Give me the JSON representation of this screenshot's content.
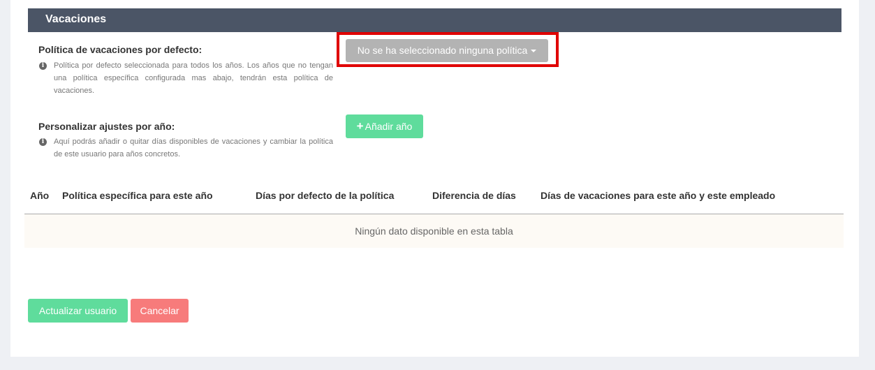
{
  "section": {
    "title": "Vacaciones"
  },
  "default_policy": {
    "label": "Política de vacaciones por defecto:",
    "help": "Política por defecto seleccionada para todos los años. Los años que no tengan una política específica configurada mas abajo, tendrán esta política de vacaciones.",
    "dropdown_value": "No se ha seleccionado ninguna política"
  },
  "custom_year": {
    "label": "Personalizar ajustes por año:",
    "help": "Aquí podrás añadir o quitar días disponibles de vacaciones y cambiar la política de este usuario para años concretos.",
    "add_button": "Añadir año"
  },
  "table": {
    "columns": [
      "Año",
      "Política específica para este año",
      "Días por defecto de la política",
      "Diferencia de días",
      "Días de vacaciones para este año y este empleado"
    ],
    "empty_message": "Ningún dato disponible en esta tabla"
  },
  "actions": {
    "update": "Actualizar usuario",
    "cancel": "Cancelar"
  },
  "colors": {
    "header_bg": "#4b5566",
    "accent_green": "#5fdc9c",
    "cancel_red": "#f77b7b",
    "highlight_red": "#e00000",
    "dropdown_gray": "#b3b3b3"
  },
  "icons": {
    "info": "info-circle-icon",
    "plus": "plus-icon",
    "caret": "caret-down-icon"
  }
}
